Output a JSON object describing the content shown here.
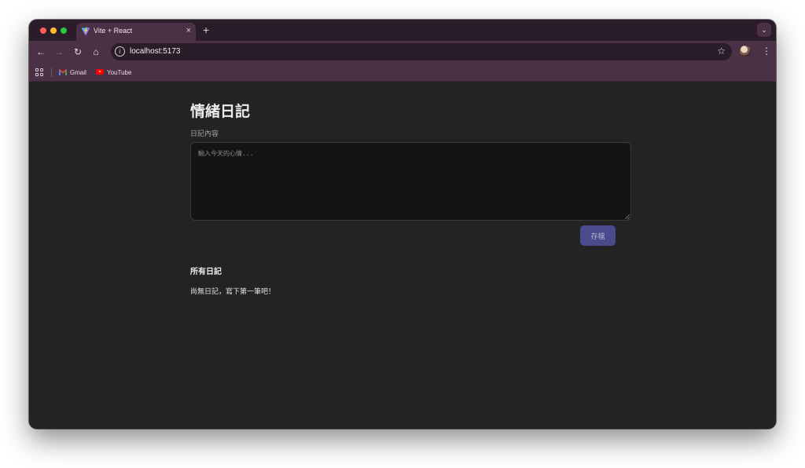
{
  "browser": {
    "tab": {
      "title": "Vite + React",
      "close": "×"
    },
    "new_tab": "+",
    "tab_search": "⌄",
    "nav": {
      "back": "←",
      "forward": "→",
      "reload": "↻",
      "home": "⌂"
    },
    "address": {
      "url": "localhost:5173",
      "site_info": "i",
      "bookmark_star": "☆"
    },
    "menu": "⋮",
    "bookmarks": [
      {
        "label": "Gmail",
        "icon": "gmail-icon"
      },
      {
        "label": "YouTube",
        "icon": "youtube-icon"
      }
    ]
  },
  "app": {
    "title": "情緒日記",
    "content_label": "日記內容",
    "textarea": {
      "value": "",
      "placeholder": "輸入今天的心情..."
    },
    "save_label": "存檔",
    "list_title": "所有日記",
    "empty_message": "尚無日記，寫下第一筆吧！"
  },
  "colors": {
    "page_bg": "#232323",
    "chrome_bg": "#4a3146",
    "save_button": "#4a4a8c"
  }
}
